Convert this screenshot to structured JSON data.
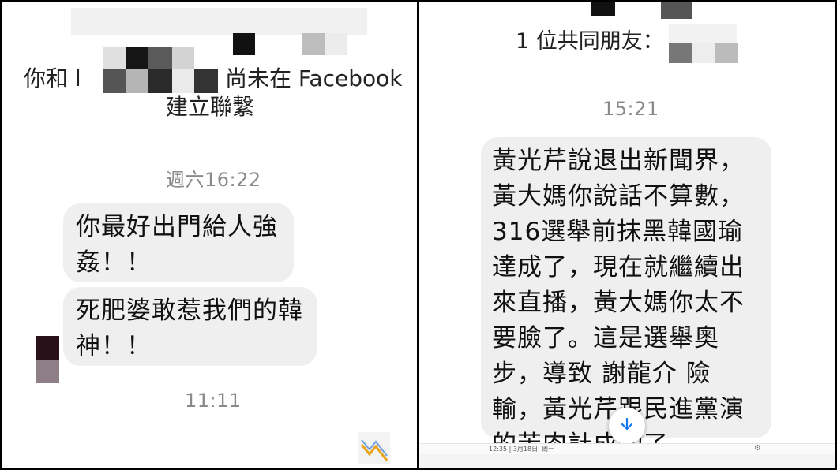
{
  "left": {
    "header_prefix": "你和 l",
    "header_suffix": "尚未在 Facebook",
    "header_line2": "建立聯繫",
    "timestamp_top": "週六16:22",
    "messages": [
      {
        "lines": [
          "你最好出門給人強",
          "姦！！"
        ]
      },
      {
        "lines": [
          "死肥婆敢惹我們的韓",
          "神！！"
        ]
      }
    ],
    "timestamp_bottom": "11:11"
  },
  "right": {
    "mutual_friends": "1 位共同朋友：",
    "timestamp": "15:21",
    "message_lines": [
      "黃光芹說退出新聞界，",
      "黃大媽你說話不算數，",
      "316選舉前抹黑韓國瑜",
      "達成了，現在就繼續出",
      "來直播，黃大媽你太不",
      "要臉了。這是選舉奧",
      "步，導致 謝龍介 險",
      "輸，黃光芹跟民進黨演",
      "的苦肉計成功了 。"
    ],
    "status_bar_text": "12:35 | 3月18日, 周一",
    "scroll_icon": "arrow-down-icon",
    "settings_icon": "gear-icon"
  },
  "colors": {
    "bubble": "#efefef",
    "timestamp": "#8a8a8a",
    "accent": "#1877f2",
    "logo": "#e8a317"
  }
}
